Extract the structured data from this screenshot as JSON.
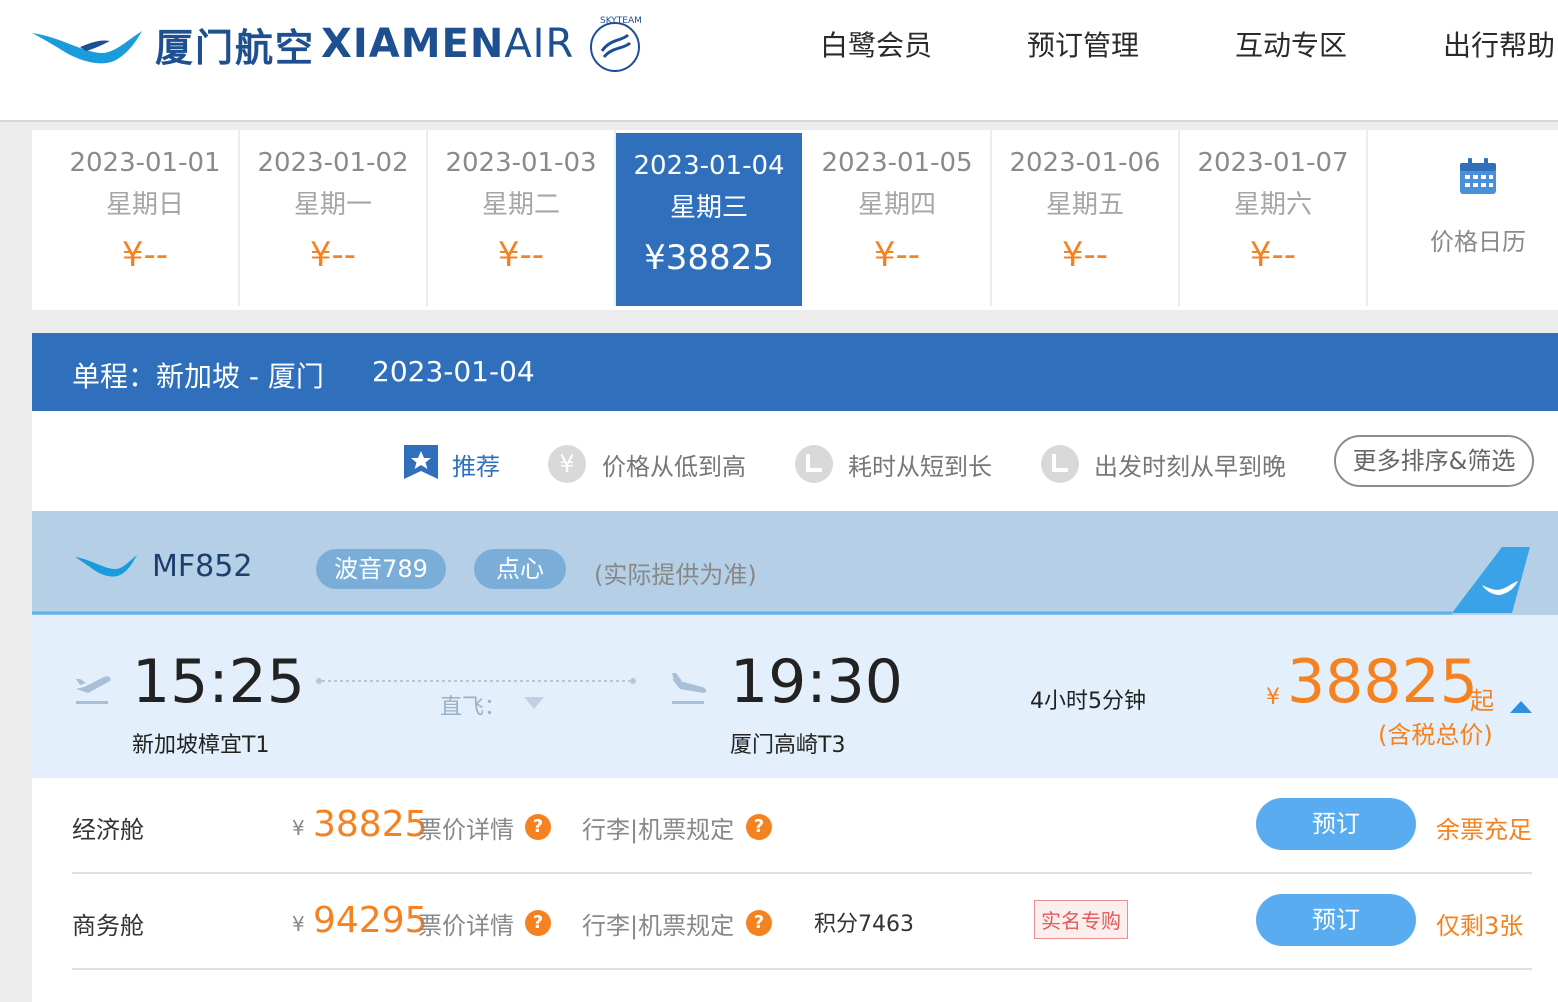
{
  "brand": {
    "cn": "厦门航空",
    "en_bold": "XIAMEN",
    "en_light": "AIR",
    "alliance": "SKYTEAM"
  },
  "nav": [
    "白鹭会员",
    "预订管理",
    "互动专区",
    "出行帮助"
  ],
  "dates": [
    {
      "date": "2023-01-01",
      "weekday": "星期日",
      "price": "¥--"
    },
    {
      "date": "2023-01-02",
      "weekday": "星期一",
      "price": "¥--"
    },
    {
      "date": "2023-01-03",
      "weekday": "星期二",
      "price": "¥--"
    },
    {
      "date": "2023-01-04",
      "weekday": "星期三",
      "price": "¥38825"
    },
    {
      "date": "2023-01-05",
      "weekday": "星期四",
      "price": "¥--"
    },
    {
      "date": "2023-01-06",
      "weekday": "星期五",
      "price": "¥--"
    },
    {
      "date": "2023-01-07",
      "weekday": "星期六",
      "price": "¥--"
    }
  ],
  "calendar_label": "价格日历",
  "route": {
    "label": "单程：新加坡 - 厦门",
    "date": "2023-01-04"
  },
  "sort": {
    "recommend": "推荐",
    "price": "价格从低到高",
    "duration": "耗时从短到长",
    "departure": "出发时刻从早到晚",
    "more": "更多排序&筛选"
  },
  "flight": {
    "number": "MF852",
    "aircraft": "波音789",
    "meal": "点心",
    "note": "(实际提供为准)",
    "dep_time": "15:25",
    "dep_airport": "新加坡樟宜T1",
    "direct": "直飞：",
    "arr_time": "19:30",
    "arr_airport": "厦门高崎T3",
    "duration": "4小时5分钟",
    "yen": "¥",
    "price": "38825",
    "from": "起",
    "tax_note": "(含税总价)"
  },
  "cabins": [
    {
      "name": "经济舱",
      "yen": "¥",
      "price": "38825",
      "fare_detail": "票价详情",
      "rules": "行李|机票规定",
      "points": "",
      "tag": "",
      "book": "预订",
      "availability": "余票充足"
    },
    {
      "name": "商务舱",
      "yen": "¥",
      "price": "94295",
      "fare_detail": "票价详情",
      "rules": "行李|机票规定",
      "points": "积分7463",
      "tag": "实名专购",
      "book": "预订",
      "availability": "仅剩3张"
    }
  ],
  "help_mark": "?"
}
